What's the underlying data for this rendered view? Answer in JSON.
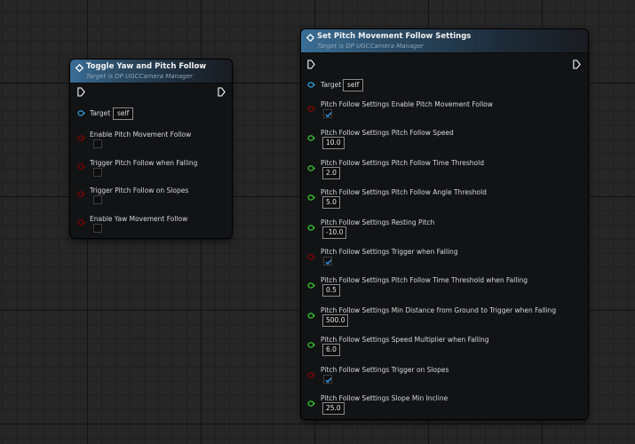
{
  "node1": {
    "title": "Toggle Yaw and Pitch Follow",
    "subtitle": "Target is DP UGCCamera Manager",
    "target": {
      "label": "Target",
      "value": "self"
    },
    "bool_inputs": [
      {
        "label": "Enable Pitch Movement Follow",
        "checked": false
      },
      {
        "label": "Trigger Pitch Follow when Falling",
        "checked": false
      },
      {
        "label": "Trigger Pitch Follow on Slopes",
        "checked": false
      },
      {
        "label": "Enable Yaw Movement Follow",
        "checked": false
      }
    ]
  },
  "node2": {
    "title": "Set Pitch Movement Follow Settings",
    "subtitle": "Target is DP UGCCamera Manager",
    "target": {
      "label": "Target",
      "value": "self"
    },
    "inputs": [
      {
        "label": "Pitch Follow Settings Enable Pitch Movement Follow",
        "type": "bool",
        "checked": true
      },
      {
        "label": "Pitch Follow Settings Pitch Follow Speed",
        "type": "float",
        "value": "10.0"
      },
      {
        "label": "Pitch Follow Settings Pitch Follow Time Threshold",
        "type": "float",
        "value": "2.0"
      },
      {
        "label": "Pitch Follow Settings Pitch Follow Angle Threshold",
        "type": "float",
        "value": "5.0"
      },
      {
        "label": "Pitch Follow Settings Resting Pitch",
        "type": "float",
        "value": "-10.0"
      },
      {
        "label": "Pitch Follow Settings Trigger when Falling",
        "type": "bool",
        "checked": true
      },
      {
        "label": "Pitch Follow Settings Pitch Follow Time Threshold when Falling",
        "type": "float",
        "value": "0.5"
      },
      {
        "label": "Pitch Follow Settings Min Distance from Ground to Trigger when Falling",
        "type": "float",
        "value": "500.0"
      },
      {
        "label": "Pitch Follow Settings Speed Multiplier when Falling",
        "type": "float",
        "value": "6.0"
      },
      {
        "label": "Pitch Follow Settings Trigger on Slopes",
        "type": "bool",
        "checked": true
      },
      {
        "label": "Pitch Follow Settings Slope Min Incline",
        "type": "float",
        "value": "25.0"
      }
    ]
  },
  "colors": {
    "object_pin": "#2aa8e8",
    "bool_pin": "#8c0000",
    "float_pin": "#38d433",
    "exec_pin": "#ffffff",
    "header_blue": "#3a6e96"
  },
  "icons": [
    "function-icon",
    "exec-pin-icon",
    "object-pin-icon",
    "bool-pin-icon",
    "float-pin-icon",
    "checkmark-icon"
  ]
}
